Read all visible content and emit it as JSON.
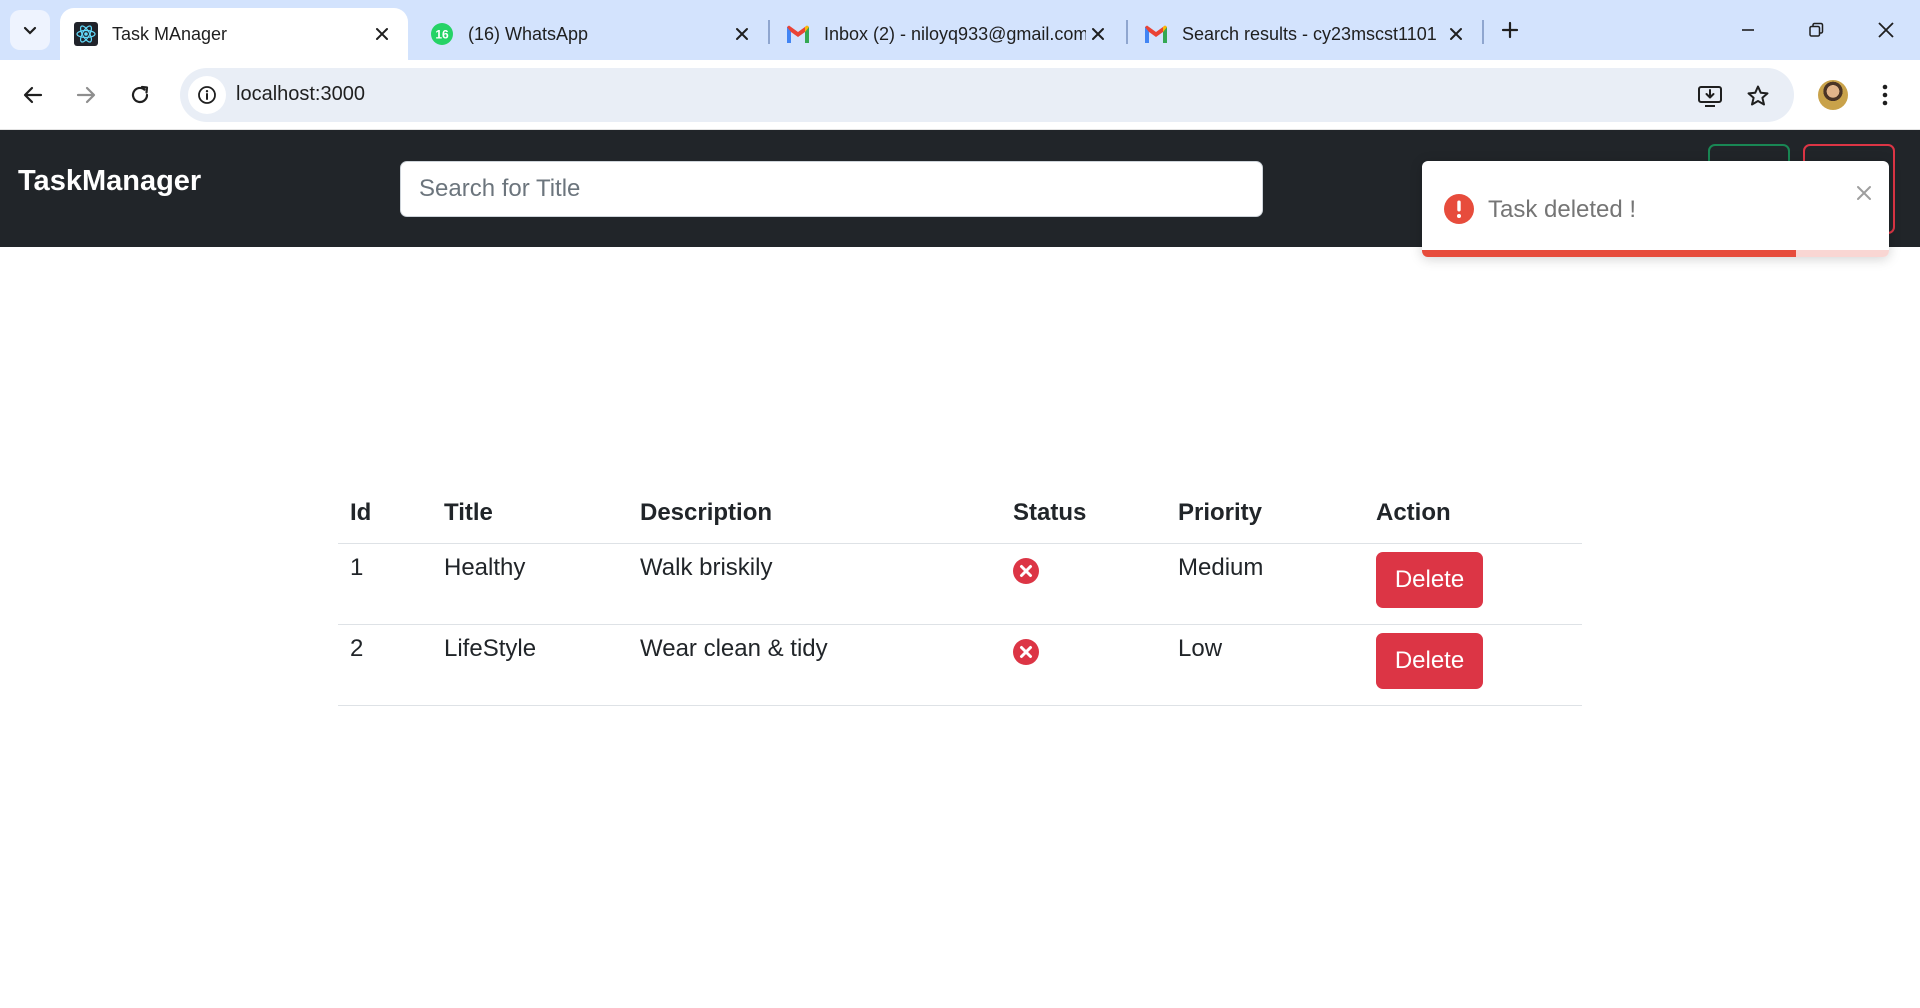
{
  "browser": {
    "tabs": [
      {
        "title": "Task MAnager",
        "favicon": "react-icon",
        "active": true
      },
      {
        "title": "(16) WhatsApp",
        "favicon": "whatsapp-icon",
        "badge": "16"
      },
      {
        "title": "Inbox (2) - niloyq933@gmail.com",
        "favicon": "gmail-icon"
      },
      {
        "title": "Search results - cy23mscst1101",
        "favicon": "gmail-icon"
      }
    ],
    "url": "localhost:3000"
  },
  "app": {
    "brand": "TaskManager",
    "search_placeholder": "Search for Title"
  },
  "toast": {
    "message": "Task deleted !",
    "type": "error",
    "progress": 0.8
  },
  "table": {
    "headers": [
      "Id",
      "Title",
      "Description",
      "Status",
      "Priority",
      "Action"
    ],
    "rows": [
      {
        "id": "1",
        "title": "Healthy",
        "description": "Walk briskily",
        "status": "incomplete",
        "priority": "Medium",
        "action": "Delete"
      },
      {
        "id": "2",
        "title": "LifeStyle",
        "description": "Wear clean & tidy",
        "status": "incomplete",
        "priority": "Low",
        "action": "Delete"
      }
    ]
  },
  "colors": {
    "navbar": "#212529",
    "danger": "#dc3545",
    "success": "#198754",
    "chrome_tabstrip": "#d3e3fd",
    "toast_progress": "#e74c3c"
  }
}
